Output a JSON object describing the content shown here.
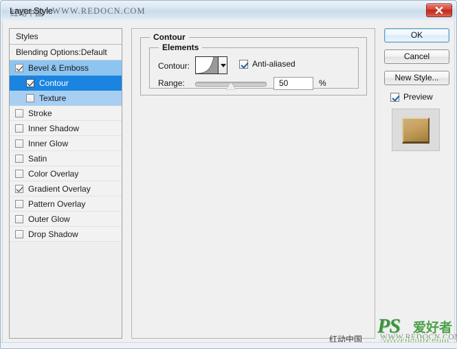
{
  "window": {
    "title": "Layer Style",
    "close_icon": "close-icon",
    "watermark_title_cn": "红动中国",
    "watermark_title_url": "WWW.REDOCN.COM"
  },
  "styles_panel": {
    "header": "Styles",
    "blending_options": "Blending Options:Default",
    "items": [
      {
        "label": "Bevel & Emboss",
        "checked": true,
        "indent": false,
        "state": "sel-parent"
      },
      {
        "label": "Contour",
        "checked": true,
        "indent": true,
        "state": "sel-strong"
      },
      {
        "label": "Texture",
        "checked": false,
        "indent": true,
        "state": "sel-light"
      },
      {
        "label": "Stroke",
        "checked": false,
        "indent": false,
        "state": ""
      },
      {
        "label": "Inner Shadow",
        "checked": false,
        "indent": false,
        "state": ""
      },
      {
        "label": "Inner Glow",
        "checked": false,
        "indent": false,
        "state": ""
      },
      {
        "label": "Satin",
        "checked": false,
        "indent": false,
        "state": ""
      },
      {
        "label": "Color Overlay",
        "checked": false,
        "indent": false,
        "state": ""
      },
      {
        "label": "Gradient Overlay",
        "checked": true,
        "indent": false,
        "state": ""
      },
      {
        "label": "Pattern Overlay",
        "checked": false,
        "indent": false,
        "state": ""
      },
      {
        "label": "Outer Glow",
        "checked": false,
        "indent": false,
        "state": ""
      },
      {
        "label": "Drop Shadow",
        "checked": false,
        "indent": false,
        "state": ""
      }
    ]
  },
  "contour_section": {
    "title": "Contour",
    "elements_title": "Elements",
    "contour_label": "Contour:",
    "contour_dropdown_icon": "chevron-down-icon",
    "anti_aliased_label": "Anti-aliased",
    "anti_aliased_checked": true,
    "range_label": "Range:",
    "range_value": "50",
    "range_unit": "%",
    "range_percent": 50
  },
  "buttons": {
    "ok": "OK",
    "cancel": "Cancel",
    "new_style": "New Style...",
    "preview_label": "Preview",
    "preview_checked": true
  },
  "watermarks": {
    "hongdong": "红动中国",
    "redocn_url": "WWW.REDOCN.COM",
    "ps_text": "PS",
    "ps_cn": "爱好者",
    "ps_url": "www.psahz.com"
  },
  "colors": {
    "titlebar_accent": "#cbdcec",
    "selection_strong": "#1a84e0",
    "selection_light": "#a7cff2",
    "close_button": "#b92c20",
    "preview_gold": "#c9a463"
  }
}
